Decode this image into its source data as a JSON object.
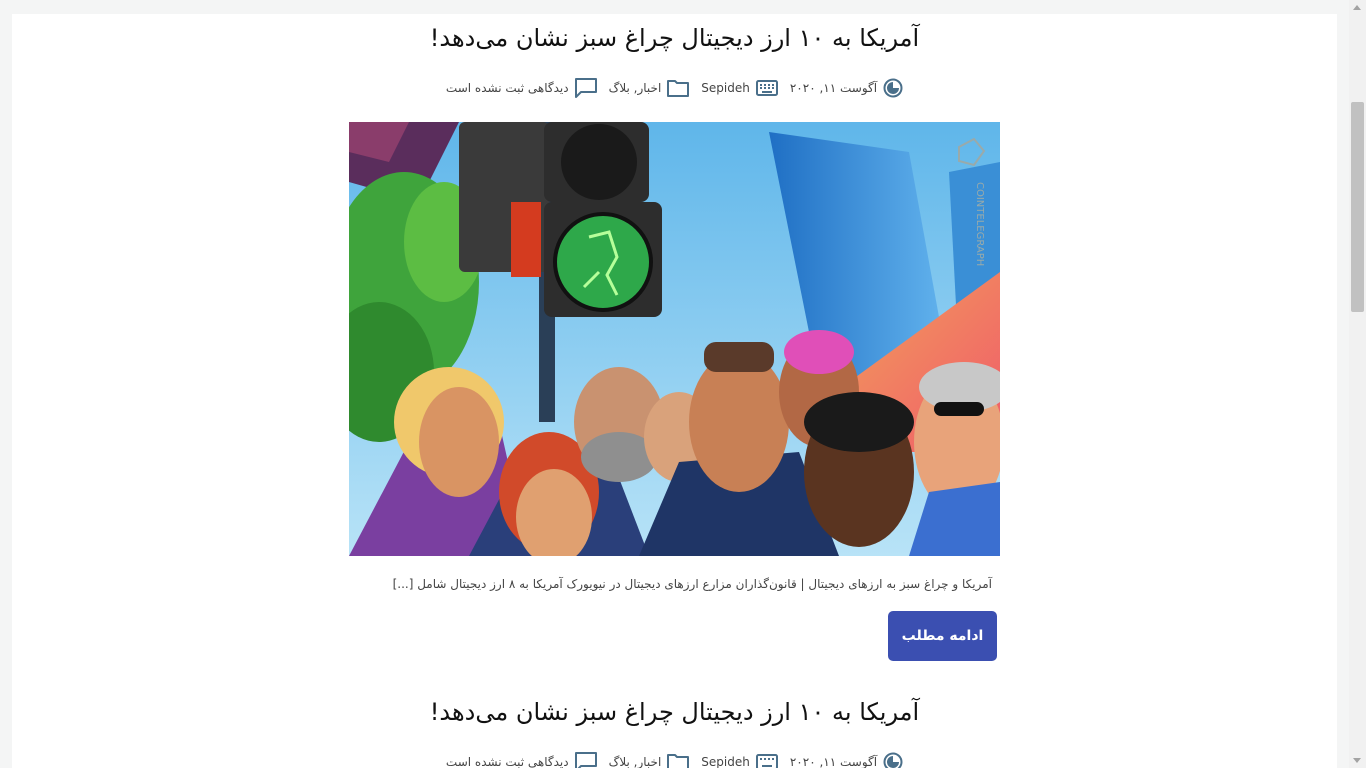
{
  "posts": [
    {
      "title": "آمریکا به ۱۰ ارز دیجیتال چراغ سبز نشان می‌دهد!",
      "meta": {
        "date": "آگوست ۱۱, ۲۰۲۰",
        "author": "Sepideh",
        "categories": "اخبار, بلاگ",
        "comments": "دیدگاهی ثبت نشده است"
      },
      "image_watermark": "COINTELEGRAPH",
      "excerpt": "آمریکا و چراغ سبز به ارزهای دیجیتال | قانون‌گذاران مزارع ارزهای دیجیتال در نیویورک آمریکا به ۸ ارز دیجیتال شامل [...]",
      "read_more": "ادامه مطلب"
    },
    {
      "title": "آمریکا به ۱۰ ارز دیجیتال چراغ سبز نشان می‌دهد!",
      "meta": {
        "date": "آگوست ۱۱, ۲۰۲۰",
        "author": "Sepideh",
        "categories": "اخبار, بلاگ",
        "comments": "دیدگاهی ثبت نشده است"
      }
    }
  ],
  "icons": {
    "date": "clock-icon",
    "author": "keyboard-icon",
    "categories": "folder-icon",
    "comments": "comment-icon"
  },
  "colors": {
    "accent": "#3b4fb1",
    "icon": "#4a6f8a",
    "background": "#f4f5f5"
  }
}
